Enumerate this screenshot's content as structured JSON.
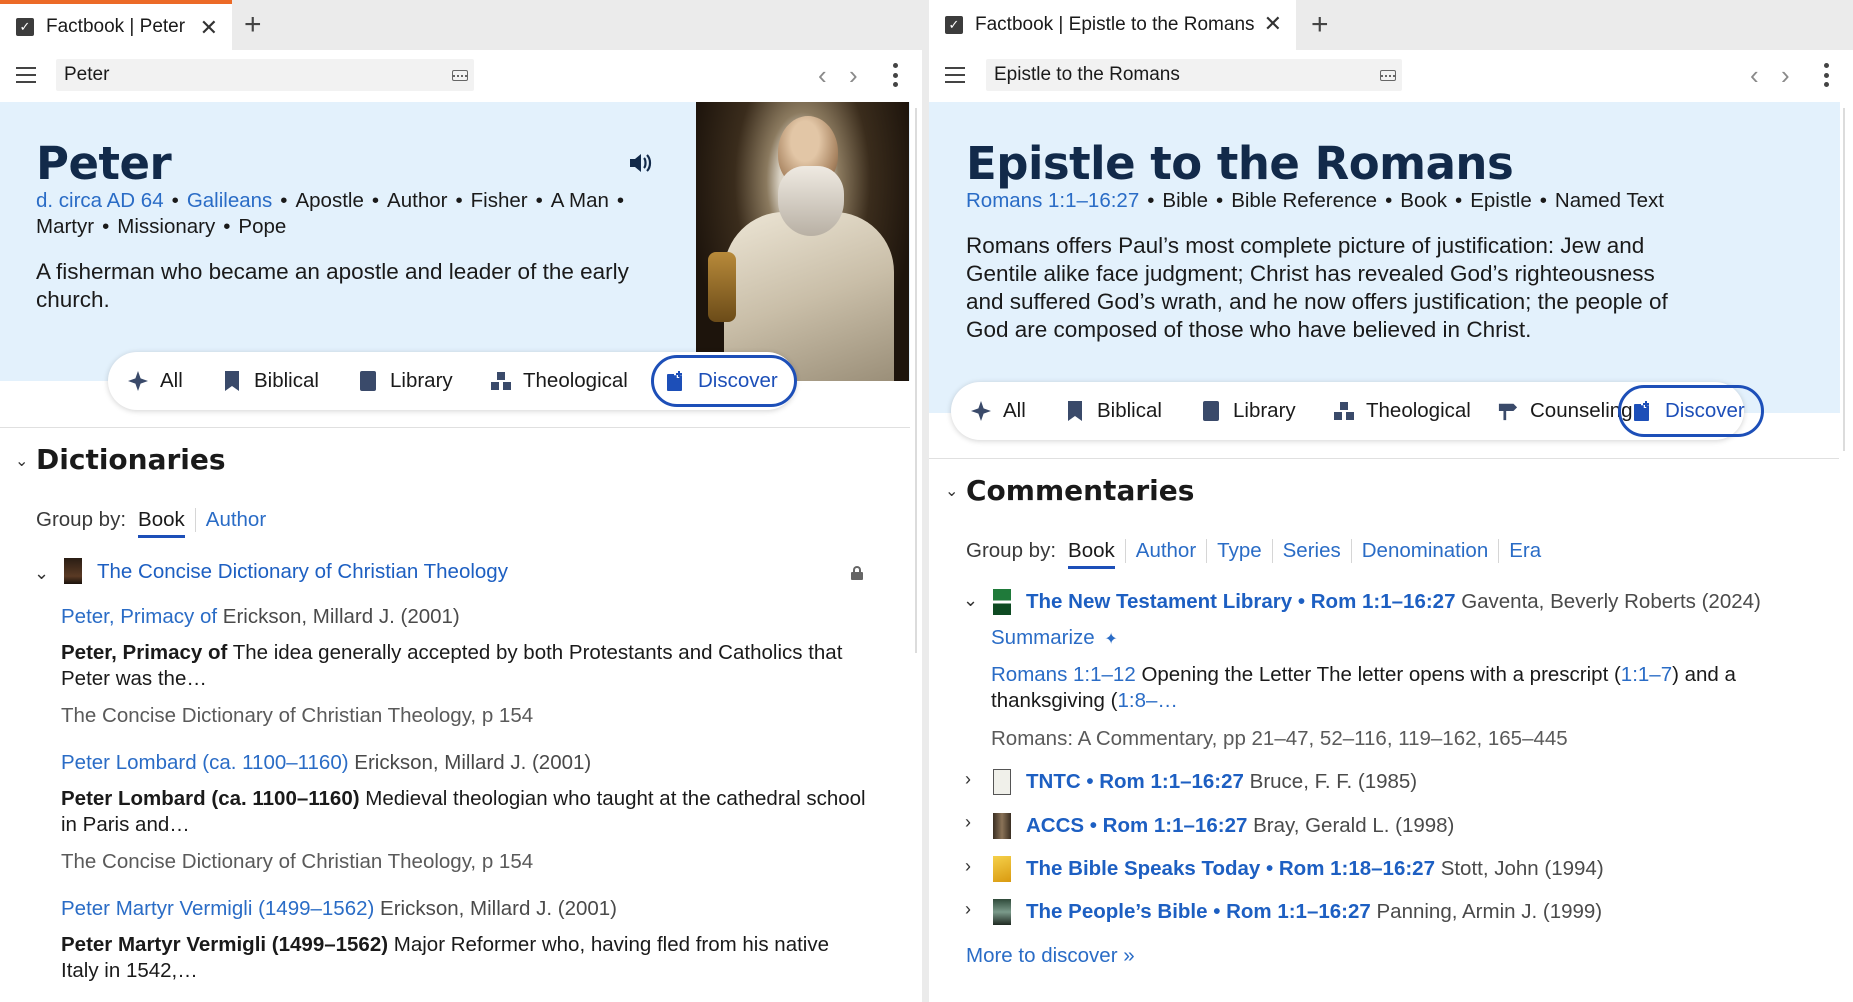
{
  "left": {
    "tab": {
      "title": "Factbook | Peter"
    },
    "address": "Peter",
    "hero": {
      "title": "Peter",
      "facts_links": [
        "d. circa AD 64",
        "Galileans"
      ],
      "facts_plain_1": [
        "Apostle",
        "Author",
        "Fisher",
        "A Man"
      ],
      "facts_plain_2": [
        "Martyr",
        "Missionary",
        "Pope"
      ],
      "description": "A fisherman who became an apostle and leader of the early church."
    },
    "filters": [
      "All",
      "Biblical",
      "Library",
      "Theological",
      "Discover"
    ],
    "section": {
      "title": "Dictionaries",
      "group_label": "Group by:",
      "group_options": [
        "Book",
        "Author"
      ],
      "book": {
        "title": "The Concise Dictionary of Christian Theology"
      },
      "entries": [
        {
          "head": "Peter, Primacy of",
          "author": "Erickson, Millard J. (2001)",
          "bold": "Peter, Primacy of",
          "text": "The idea generally accepted by both Protestants and Catholics that Peter was the…",
          "source": "The Concise Dictionary of Christian Theology, p 154"
        },
        {
          "head": "Peter Lombard (ca. 1100–1160)",
          "author": "Erickson, Millard J. (2001)",
          "bold": "Peter Lombard (ca. 1100–1160)",
          "text": "Medieval theologian who taught at the cathedral school in Paris and…",
          "source": "The Concise Dictionary of Christian Theology, p 154"
        },
        {
          "head": "Peter Martyr Vermigli (1499–1562)",
          "author": "Erickson, Millard J. (2001)",
          "bold": "Peter Martyr Vermigli (1499–1562)",
          "text": "Major Reformer who, having fled from his native Italy in 1542,…"
        }
      ]
    }
  },
  "right": {
    "tab": {
      "title": "Factbook | Epistle to the Romans"
    },
    "address": "Epistle to the Romans",
    "hero": {
      "title": "Epistle to the Romans",
      "facts_link": "Romans 1:1–16:27",
      "facts_plain": [
        "Bible",
        "Bible Reference",
        "Book",
        "Epistle",
        "Named Text"
      ],
      "description": "Romans offers Paul’s most complete picture of justification: Jew and Gentile alike face judgment; Christ has revealed God’s righteousness and suffered God’s wrath, and he now offers justification; the people of God are composed of those who have believed in Christ."
    },
    "filters": [
      "All",
      "Biblical",
      "Library",
      "Theological",
      "Counseling",
      "Discover"
    ],
    "section": {
      "title": "Commentaries",
      "group_label": "Group by:",
      "group_options": [
        "Book",
        "Author",
        "Type",
        "Series",
        "Denomination",
        "Era"
      ],
      "books": [
        {
          "title": "The New Testament Library • Rom 1:1–16:27",
          "author": "Gaventa, Beverly Roberts (2024)",
          "thumb_color": "#1f7a3a"
        },
        {
          "title": "TNTC • Rom 1:1–16:27",
          "author": "Bruce, F. F. (1985)",
          "thumb_color": "#e8e8e0"
        },
        {
          "title": "ACCS • Rom 1:1–16:27",
          "author": "Bray, Gerald L. (1998)",
          "thumb_color": "#5a4a3a"
        },
        {
          "title": "The Bible Speaks Today • Rom 1:18–16:27",
          "author": "Stott, John (1994)",
          "thumb_color": "#e6b21e"
        },
        {
          "title": "The People’s Bible • Rom 1:1–16:27",
          "author": "Panning, Armin J. (1999)",
          "thumb_color": "#2f4a3a"
        }
      ],
      "summarize": "Summarize",
      "excerpt": {
        "ref": "Romans 1:1–12",
        "text_a": "Opening the Letter The letter opens with a prescript (",
        "ref2": "1:1–7",
        "text_b": ") and a thanksgiving (",
        "ref3": "1:8–…",
        "source": "Romans: A Commentary, pp 21–47, 52–116, 119–162, 165–445"
      },
      "more": "More to discover »"
    }
  },
  "colors": {
    "accent": "#1d4fb8",
    "link": "#2a6cc6",
    "hero_bg": "#e3f1fc",
    "tab_indicator": "#ec6a27"
  }
}
